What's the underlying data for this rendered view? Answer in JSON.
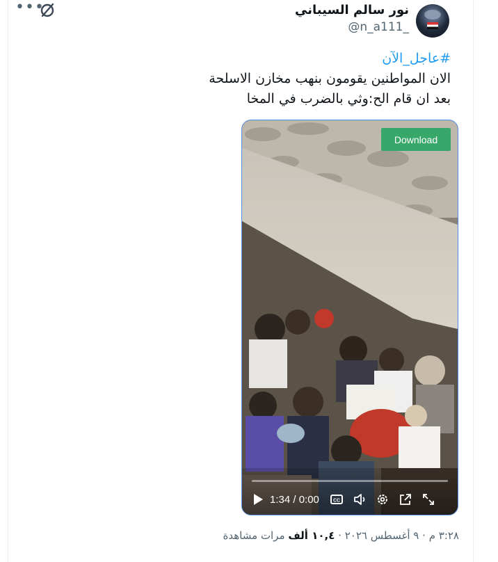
{
  "author": {
    "name": "نور سالم السيباني",
    "handle": "@n_a111_"
  },
  "header_icons": [
    "more-icon",
    "grok-icon"
  ],
  "tweet": {
    "hashtag": "#عاجل_الآن",
    "line1": "الان المواطنين يقومون بنهب مخازن الاسلحة",
    "line2": "بعد ان قام الح:وثي بالضرب في المخا"
  },
  "video": {
    "download_label": "Download",
    "time_label": "1:34 / 0:00",
    "icons": [
      "play-icon",
      "cc-icon",
      "volume-icon",
      "settings-icon",
      "popout-icon",
      "fullscreen-icon"
    ]
  },
  "meta": {
    "time": "٣:٢٨ م",
    "sep1": "·",
    "date": "٩ أغسطس ٢٠٢٦",
    "sep2": "·",
    "views_count": "١٠,٤ ألف",
    "views_label": "مرات مشاهدة"
  },
  "colors": {
    "accent": "#1d9bf0",
    "download": "#38a86a",
    "muted": "#536471"
  }
}
